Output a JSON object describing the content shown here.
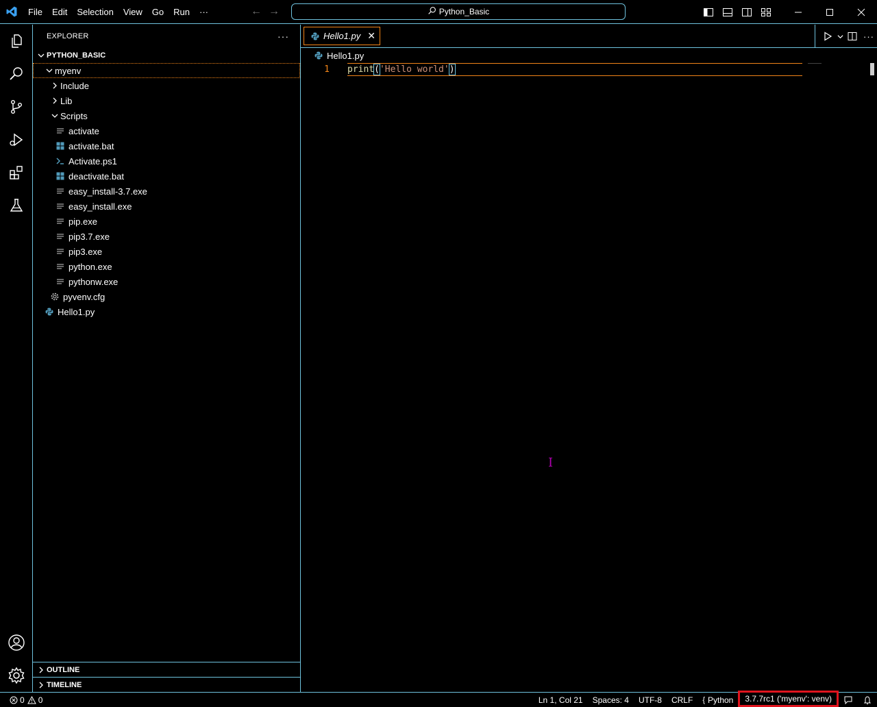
{
  "menu": [
    "File",
    "Edit",
    "Selection",
    "View",
    "Go",
    "Run",
    "···"
  ],
  "command_center": "Python_Basic",
  "explorer": {
    "title": "EXPLORER",
    "more": "···",
    "root": "PYTHON_BASIC",
    "tree": [
      {
        "label": "myenv",
        "level": 1,
        "type": "folder-open",
        "selected": true
      },
      {
        "label": "Include",
        "level": 2,
        "type": "folder-closed"
      },
      {
        "label": "Lib",
        "level": 2,
        "type": "folder-closed"
      },
      {
        "label": "Scripts",
        "level": 2,
        "type": "folder-open"
      },
      {
        "label": "activate",
        "level": 3,
        "type": "lines-icon"
      },
      {
        "label": "activate.bat",
        "level": 3,
        "type": "windows-icon"
      },
      {
        "label": "Activate.ps1",
        "level": 3,
        "type": "terminal-icon"
      },
      {
        "label": "deactivate.bat",
        "level": 3,
        "type": "windows-icon"
      },
      {
        "label": "easy_install-3.7.exe",
        "level": 3,
        "type": "lines-icon"
      },
      {
        "label": "easy_install.exe",
        "level": 3,
        "type": "lines-icon"
      },
      {
        "label": "pip.exe",
        "level": 3,
        "type": "lines-icon"
      },
      {
        "label": "pip3.7.exe",
        "level": 3,
        "type": "lines-icon"
      },
      {
        "label": "pip3.exe",
        "level": 3,
        "type": "lines-icon"
      },
      {
        "label": "python.exe",
        "level": 3,
        "type": "lines-icon"
      },
      {
        "label": "pythonw.exe",
        "level": 3,
        "type": "lines-icon"
      },
      {
        "label": "pyvenv.cfg",
        "level": 2,
        "type": "gear-icon"
      },
      {
        "label": "Hello1.py",
        "level": 1,
        "type": "python-icon"
      }
    ],
    "outline": "OUTLINE",
    "timeline": "TIMELINE"
  },
  "editor": {
    "tab_label": "Hello1.py",
    "tab_close": "✕",
    "breadcrumb": "Hello1.py",
    "line_number": "1",
    "code": {
      "fn": "print",
      "open": "(",
      "str": "'Hello world'",
      "close": ")"
    }
  },
  "status": {
    "errors": "0",
    "warnings": "0",
    "position": "Ln 1, Col 21",
    "spaces": "Spaces: 4",
    "encoding": "UTF-8",
    "eol": "CRLF",
    "language": "Python",
    "interpreter": "3.7.7rc1 ('myenv': venv)"
  },
  "colors": {
    "contrast_border": "#6fc3df",
    "active_border": "#f38518",
    "highlight_box": "#e0141e",
    "string": "#ce9178",
    "function": "#dcdcaa"
  }
}
